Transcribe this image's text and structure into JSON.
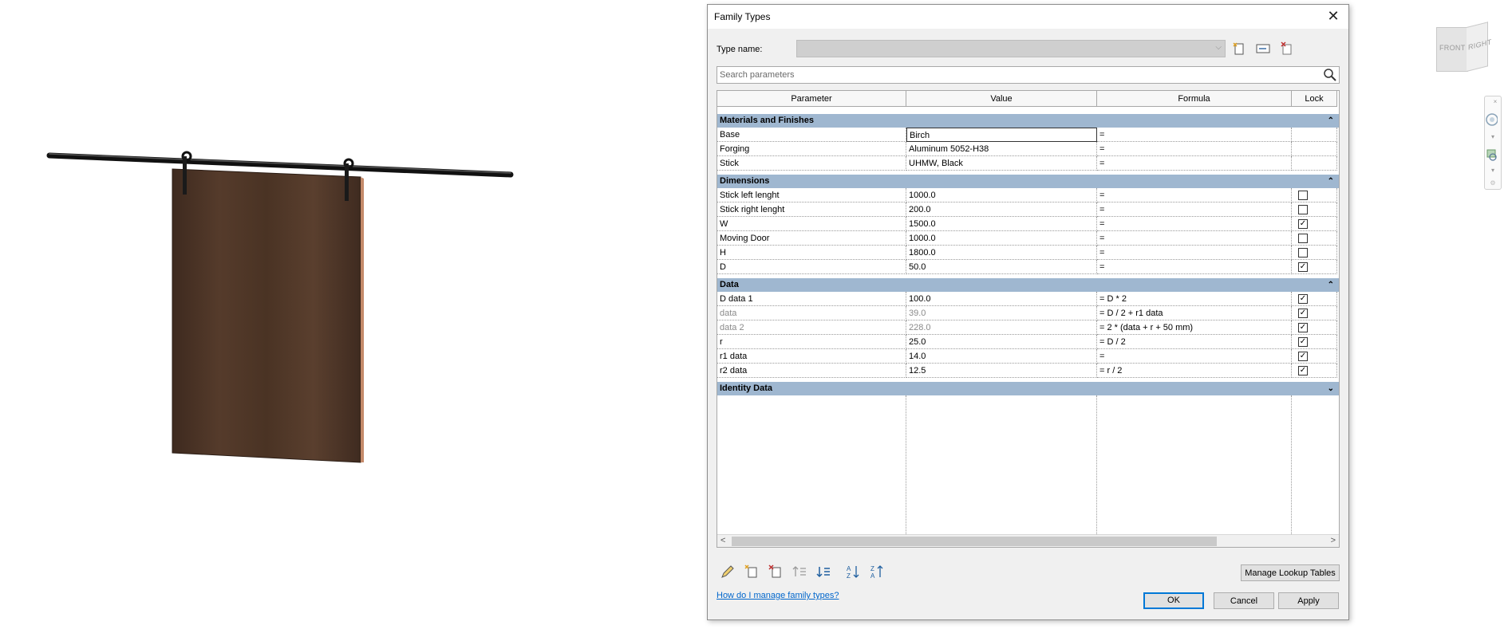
{
  "dialog": {
    "title": "Family Types",
    "type_name_label": "Type name:",
    "type_name_value": "",
    "search_placeholder": "Search parameters",
    "columns": {
      "parameter": "Parameter",
      "value": "Value",
      "formula": "Formula",
      "lock": "Lock"
    },
    "groups": [
      {
        "name": "Materials and Finishes",
        "expanded": true,
        "chevron": "⌃",
        "rows": [
          {
            "parameter": "Base",
            "value": "Birch",
            "formula": "=",
            "lock": null,
            "editing": true
          },
          {
            "parameter": "Forging",
            "value": "Aluminum 5052-H38",
            "formula": "=",
            "lock": null
          },
          {
            "parameter": "Stick",
            "value": "UHMW, Black",
            "formula": "=",
            "lock": null
          }
        ]
      },
      {
        "name": "Dimensions",
        "expanded": true,
        "chevron": "⌃",
        "rows": [
          {
            "parameter": "Stick left lenght",
            "value": "1000.0",
            "formula": "=",
            "lock": false
          },
          {
            "parameter": "Stick right lenght",
            "value": "200.0",
            "formula": "=",
            "lock": false
          },
          {
            "parameter": "W",
            "value": "1500.0",
            "formula": "=",
            "lock": true
          },
          {
            "parameter": "Moving Door",
            "value": "1000.0",
            "formula": "=",
            "lock": false
          },
          {
            "parameter": "H",
            "value": "1800.0",
            "formula": "=",
            "lock": false
          },
          {
            "parameter": "D",
            "value": "50.0",
            "formula": "=",
            "lock": true
          }
        ]
      },
      {
        "name": "Data",
        "expanded": true,
        "chevron": "⌃",
        "rows": [
          {
            "parameter": "D data 1",
            "value": "100.0",
            "formula": "= D * 2",
            "lock": true
          },
          {
            "parameter": "data",
            "value": "39.0",
            "formula": "= D / 2 + r1 data",
            "lock": true,
            "disabled": true
          },
          {
            "parameter": "data 2",
            "value": "228.0",
            "formula": "= 2 * (data + r + 50 mm)",
            "lock": true,
            "disabled": true
          },
          {
            "parameter": "r",
            "value": "25.0",
            "formula": "= D / 2",
            "lock": true
          },
          {
            "parameter": "r1 data",
            "value": "14.0",
            "formula": "=",
            "lock": true
          },
          {
            "parameter": "r2 data",
            "value": "12.5",
            "formula": "= r / 2",
            "lock": true
          }
        ]
      },
      {
        "name": "Identity Data",
        "expanded": false,
        "chevron": "⌄",
        "rows": []
      }
    ],
    "buttons": {
      "manage_lookup": "Manage Lookup Tables",
      "ok": "OK",
      "cancel": "Cancel",
      "apply": "Apply"
    },
    "help_link": "How do I manage family types?",
    "toolbar_icons": [
      "pencil-icon",
      "new-parameter-icon",
      "delete-parameter-icon",
      "move-up-icon",
      "move-down-icon",
      "sort-ascending-icon",
      "sort-descending-icon"
    ],
    "type_icons": [
      "new-type-icon",
      "rename-type-icon",
      "delete-type-icon"
    ]
  },
  "viewcube": {
    "front": "FRONT",
    "right": "RIGHT"
  },
  "colors": {
    "group_header": "#9fb7d0",
    "link": "#0066cc",
    "door_wood": "#4b3426",
    "door_edge": "#c48a6a",
    "accent": "#0078d7"
  }
}
